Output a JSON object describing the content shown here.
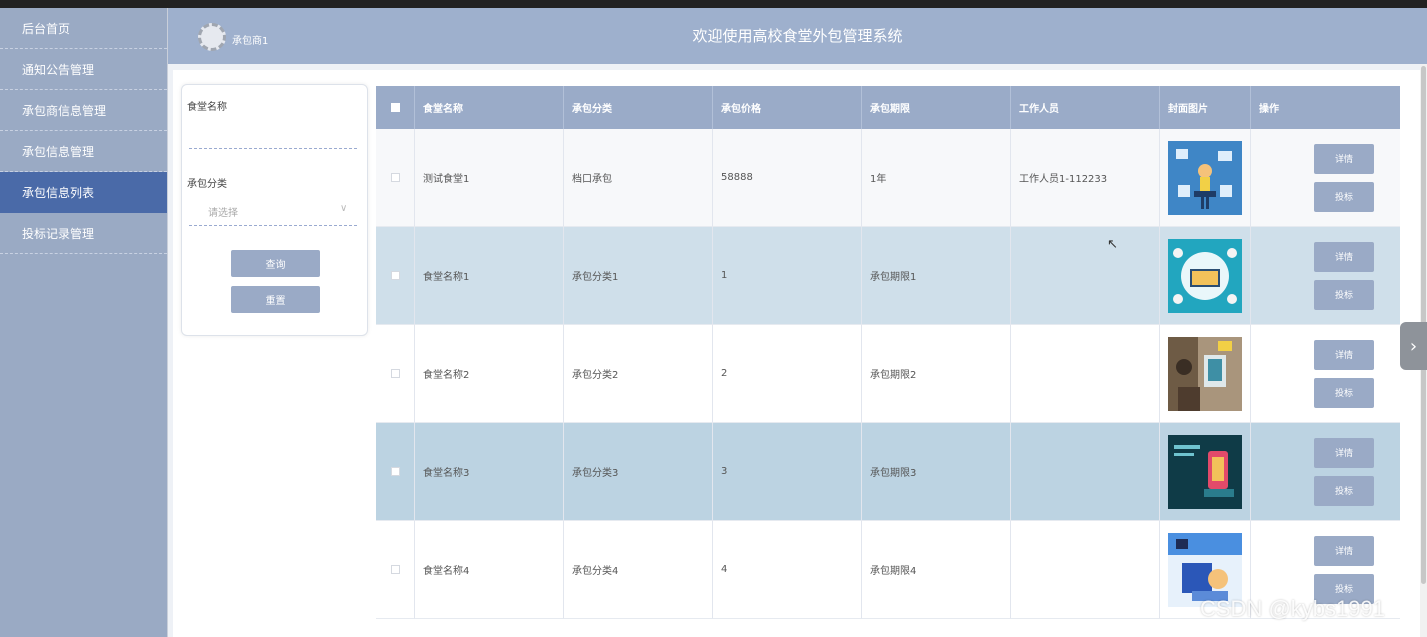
{
  "sidebar": {
    "items": [
      {
        "label": "后台首页"
      },
      {
        "label": "通知公告管理"
      },
      {
        "label": "承包商信息管理"
      },
      {
        "label": "承包信息管理"
      },
      {
        "label": "承包信息列表"
      },
      {
        "label": "投标记录管理"
      }
    ],
    "active_index": 4
  },
  "header": {
    "user": "承包商1",
    "title": "欢迎使用高校食堂外包管理系统"
  },
  "search": {
    "name_label": "食堂名称",
    "category_label": "承包分类",
    "category_placeholder": "请选择",
    "query_button": "查询",
    "reset_button": "重置"
  },
  "table": {
    "headers": [
      "食堂名称",
      "承包分类",
      "承包价格",
      "承包期限",
      "工作人员",
      "封面图片",
      "操作"
    ],
    "rows": [
      {
        "name": "测试食堂1",
        "category": "档口承包",
        "price": "58888",
        "term": "1年",
        "staff": "工作人员1-112233"
      },
      {
        "name": "食堂名称1",
        "category": "承包分类1",
        "price": "1",
        "term": "承包期限1",
        "staff": ""
      },
      {
        "name": "食堂名称2",
        "category": "承包分类2",
        "price": "2",
        "term": "承包期限2",
        "staff": ""
      },
      {
        "name": "食堂名称3",
        "category": "承包分类3",
        "price": "3",
        "term": "承包期限3",
        "staff": ""
      },
      {
        "name": "食堂名称4",
        "category": "承包分类4",
        "price": "4",
        "term": "承包期限4",
        "staff": ""
      }
    ],
    "detail_label": "详情",
    "bid_label": "投标"
  },
  "watermark": "CSDN @kybs1991",
  "colors": {
    "sidebar": "#9aaac4",
    "sidebar_active": "#4a6aa8",
    "header": "#9eb0cd",
    "button": "#9aaac6",
    "row_blue": "#bcd3e2"
  }
}
